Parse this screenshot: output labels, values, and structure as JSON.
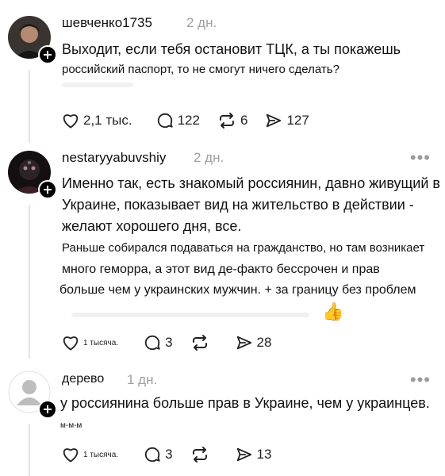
{
  "posts": [
    {
      "username": "шевченко1735",
      "time": "2 дн.",
      "lines": [
        "Выходит, если тебя остановит ТЦК, а ты покажешь",
        "российский паспорт, то не смогут ничего сделать?"
      ],
      "likes": "2,1 тыс.",
      "replies": "122",
      "reposts": "6",
      "shares": "127"
    },
    {
      "username": "nestaryyabuvshiy",
      "time": "2 дн.",
      "lines": [
        "Именно так, есть знакомый россиянин, давно живущий в",
        "Украине, показывает вид на жительство в действии -",
        "желают хорошего дня, все.",
        "Раньше собирался подаваться на гражданство, но там возникает",
        "много геморра, а этот вид де-факто бессрочен и прав",
        "больше чем у украинских мужчин. + за границу без проблем"
      ],
      "emoji": "👍",
      "likes": "1 тысяча.",
      "replies": "3",
      "reposts": "",
      "shares": "28"
    },
    {
      "username": "дерево",
      "time": "1 дн.",
      "lines": [
        "у россиянина больше прав в Украине, чем у украинцев.",
        "м-м-м"
      ],
      "likes": "1 тысяча.",
      "replies": "3",
      "reposts": "",
      "shares": "13"
    }
  ],
  "icons": {
    "more": "more-horizontal-icon",
    "like": "heart-icon",
    "reply": "comment-bubble-icon",
    "repost": "repost-arrows-icon",
    "share": "send-icon",
    "follow": "plus-icon"
  },
  "colors": {
    "text": "#111111",
    "muted": "#a0a0a0",
    "icon": "#222222",
    "thread_line": "#e4e4e4"
  }
}
